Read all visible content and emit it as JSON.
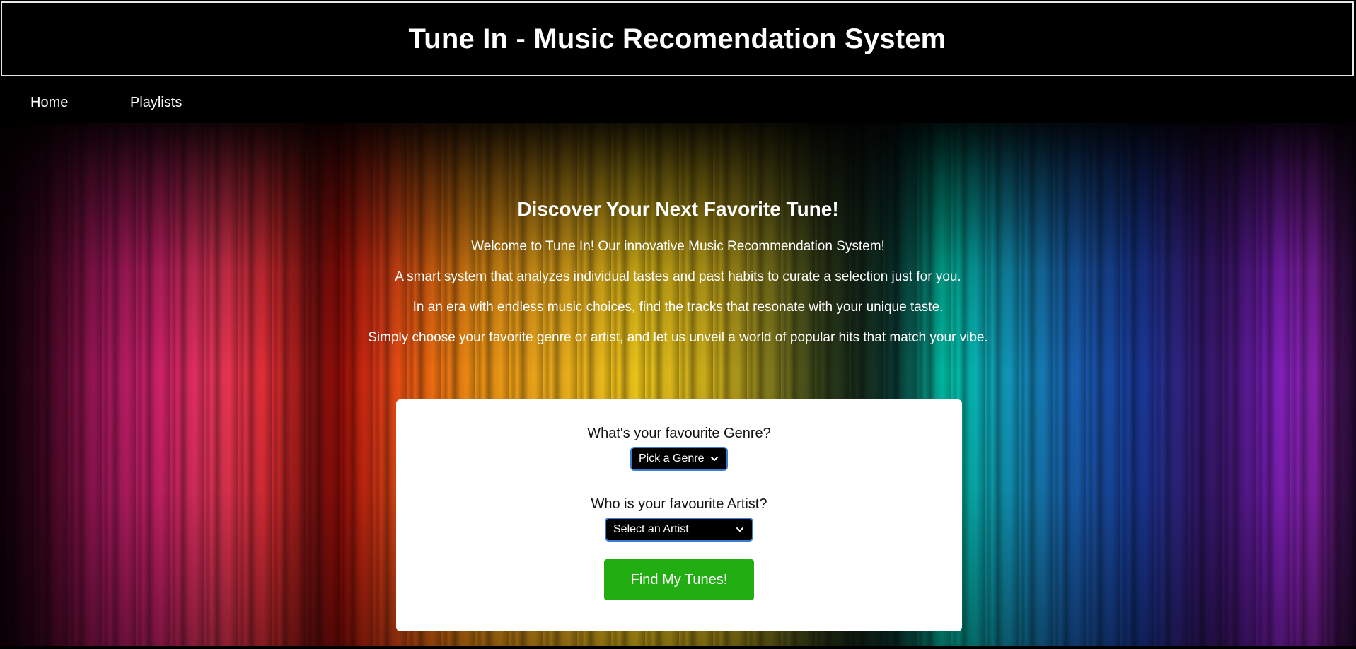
{
  "header": {
    "title": "Tune In - Music Recomendation System"
  },
  "nav": {
    "items": [
      {
        "label": "Home"
      },
      {
        "label": "Playlists"
      }
    ]
  },
  "hero": {
    "title": "Discover Your Next Favorite Tune!",
    "lines": [
      "Welcome to Tune In! Our innovative Music Recommendation System!",
      "A smart system that analyzes individual tastes and past habits to curate a selection just for you.",
      "In an era with endless music choices, find the tracks that resonate with your unique taste.",
      "Simply choose your favorite genre or artist, and let us unveil a world of popular hits that match your vibe."
    ]
  },
  "form": {
    "genre_label": "What's your favourite Genre?",
    "genre_selected": "Pick a Genre",
    "artist_label": "Who is your favourite Artist?",
    "artist_selected": "Select an Artist",
    "submit_label": "Find My Tunes!"
  },
  "icons": {
    "select_chevron": "chevron-down-icon"
  },
  "colors": {
    "page_background": "#000000",
    "header_border": "#e8e8e8",
    "card_background": "#ffffff",
    "select_background": "#000000",
    "select_border": "#3a7bd5",
    "button_background": "#22ad12",
    "text_light": "#ffffff",
    "text_dark": "#111111"
  }
}
